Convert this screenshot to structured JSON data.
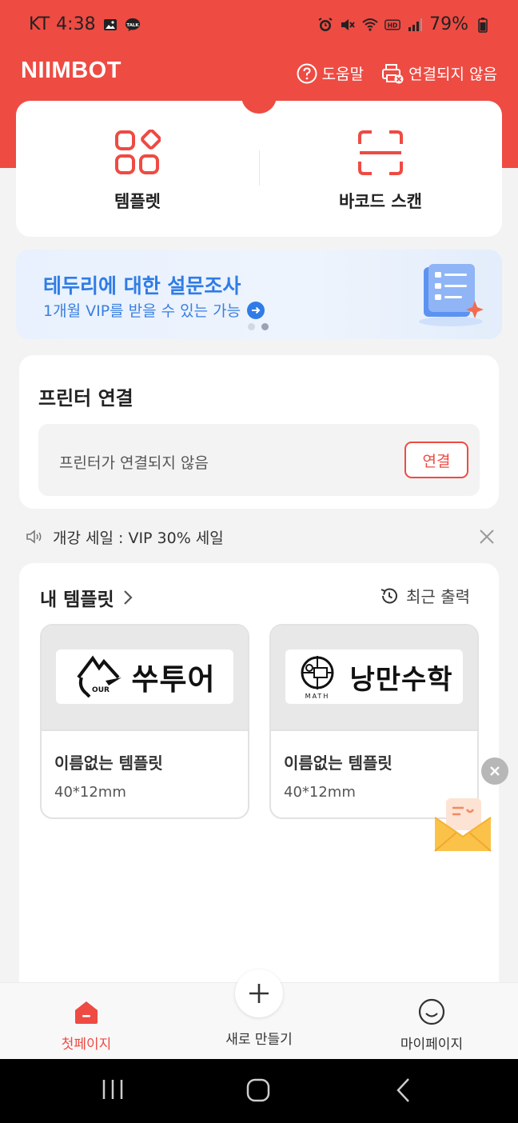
{
  "status_bar": {
    "carrier": "KT",
    "time": "4:38",
    "battery": "79%"
  },
  "header": {
    "app_title": "NIIMBOT",
    "help_label": "도움말",
    "connection_label": "연결되지 않음"
  },
  "quick_actions": [
    {
      "label": "템플렛",
      "icon": "template-grid-icon"
    },
    {
      "label": "바코드 스캔",
      "icon": "barcode-scan-icon"
    }
  ],
  "banner": {
    "title": "테두리에 대한 설문조사",
    "subtitle": "1개월 VIP를 받을 수 있는 가능",
    "slide_count": 2,
    "active_slide": 2
  },
  "printer": {
    "title": "프린터 연결",
    "status": "프린터가 연결되지 않음",
    "connect_label": "연결"
  },
  "notice": {
    "text": "개강 세일 : VIP 30% 세일"
  },
  "my_templates": {
    "title": "내 템플릿",
    "recent_label": "최근 출력",
    "items": [
      {
        "label_text": "쑤투어",
        "logo_text": "OUR",
        "name": "이름없는 템플릿",
        "size": "40*12mm"
      },
      {
        "label_text": "낭만수학",
        "logo_text": "MATH",
        "name": "이름없는 템플릿",
        "size": "40*12mm"
      }
    ]
  },
  "bottom_nav": {
    "home_label": "첫페이지",
    "create_label": "새로 만들기",
    "mypage_label": "마이페이지"
  },
  "colors": {
    "brand": "#ee4b43",
    "banner_text": "#2f7ce6"
  }
}
